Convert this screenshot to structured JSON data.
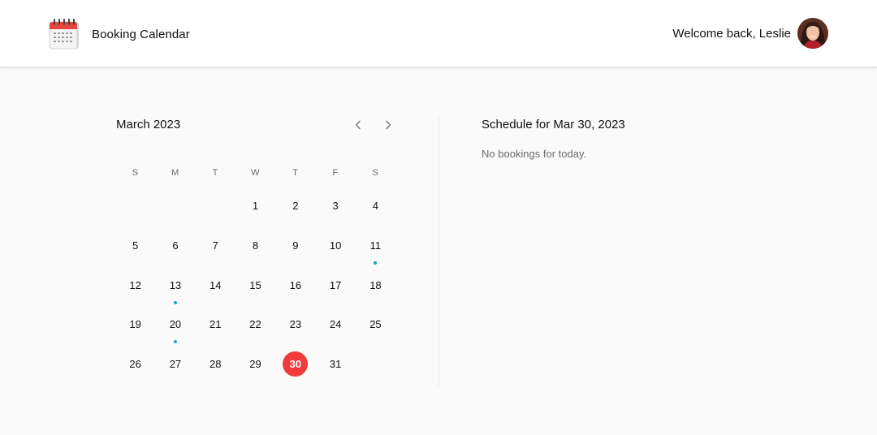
{
  "header": {
    "title": "Booking Calendar",
    "logo_icon": "calendar-icon",
    "welcome": "Welcome back, Leslie",
    "avatar_icon": "user-avatar"
  },
  "calendar": {
    "month_label": "March 2023",
    "prev_icon": "chevron-left-icon",
    "next_icon": "chevron-right-icon",
    "weekdays": [
      "S",
      "M",
      "T",
      "W",
      "T",
      "F",
      "S"
    ],
    "leading_blanks": 3,
    "days": [
      "1",
      "2",
      "3",
      "4",
      "5",
      "6",
      "7",
      "8",
      "9",
      "10",
      "11",
      "12",
      "13",
      "14",
      "15",
      "16",
      "17",
      "18",
      "19",
      "20",
      "21",
      "22",
      "23",
      "24",
      "25",
      "26",
      "27",
      "28",
      "29",
      "30",
      "31"
    ],
    "selected_day": "30",
    "days_with_bookings": [
      "11",
      "13",
      "20"
    ]
  },
  "colors": {
    "selected": "#ef3b3b",
    "booking_dot": "#1ca0d0"
  },
  "schedule": {
    "title": "Schedule for Mar 30, 2023",
    "empty_text": "No bookings for today."
  }
}
